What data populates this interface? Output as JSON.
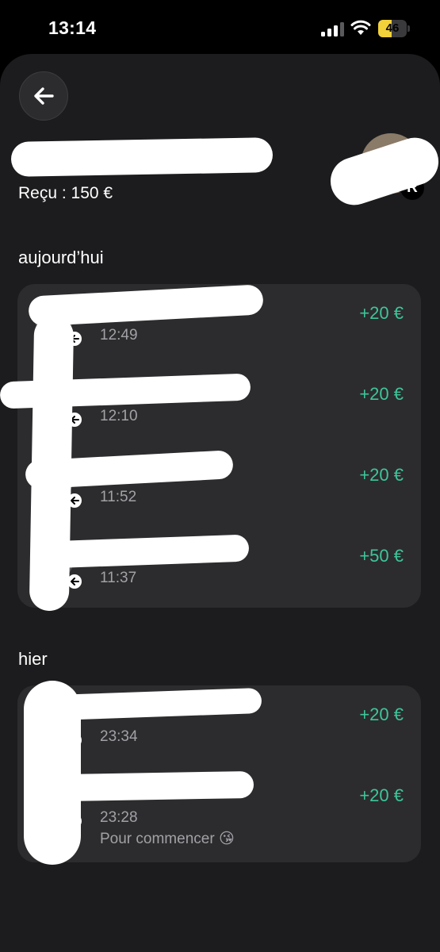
{
  "status_bar": {
    "time": "13:14",
    "battery_level": "46",
    "battery_color": "#f3d13a",
    "signal_icon": "cellular-signal-icon",
    "wifi_icon": "wifi-icon"
  },
  "header": {
    "back_icon": "arrow-left-icon",
    "name": "",
    "received": "Reçu : 150 €",
    "badge_letter": "R"
  },
  "sections": [
    {
      "title": "aujourd’hui",
      "transactions": [
        {
          "name": "",
          "time": "12:49",
          "amount": "+20 €"
        },
        {
          "name": "",
          "time": "12:10",
          "amount": "+20 €"
        },
        {
          "name": "",
          "time": "11:52",
          "amount": "+20 €"
        },
        {
          "name": "",
          "time": "11:37",
          "amount": "+50 €"
        }
      ]
    },
    {
      "title": "hier",
      "transactions": [
        {
          "name": "",
          "time": "23:34",
          "amount": "+20 €"
        },
        {
          "name": "",
          "time": "23:28",
          "amount": "+20 €",
          "note": "Pour commencer 😘"
        }
      ]
    }
  ],
  "colors": {
    "positive_amount": "#3ec59a",
    "sheet_background": "#1c1c1e",
    "card_background": "#2c2c2e"
  }
}
